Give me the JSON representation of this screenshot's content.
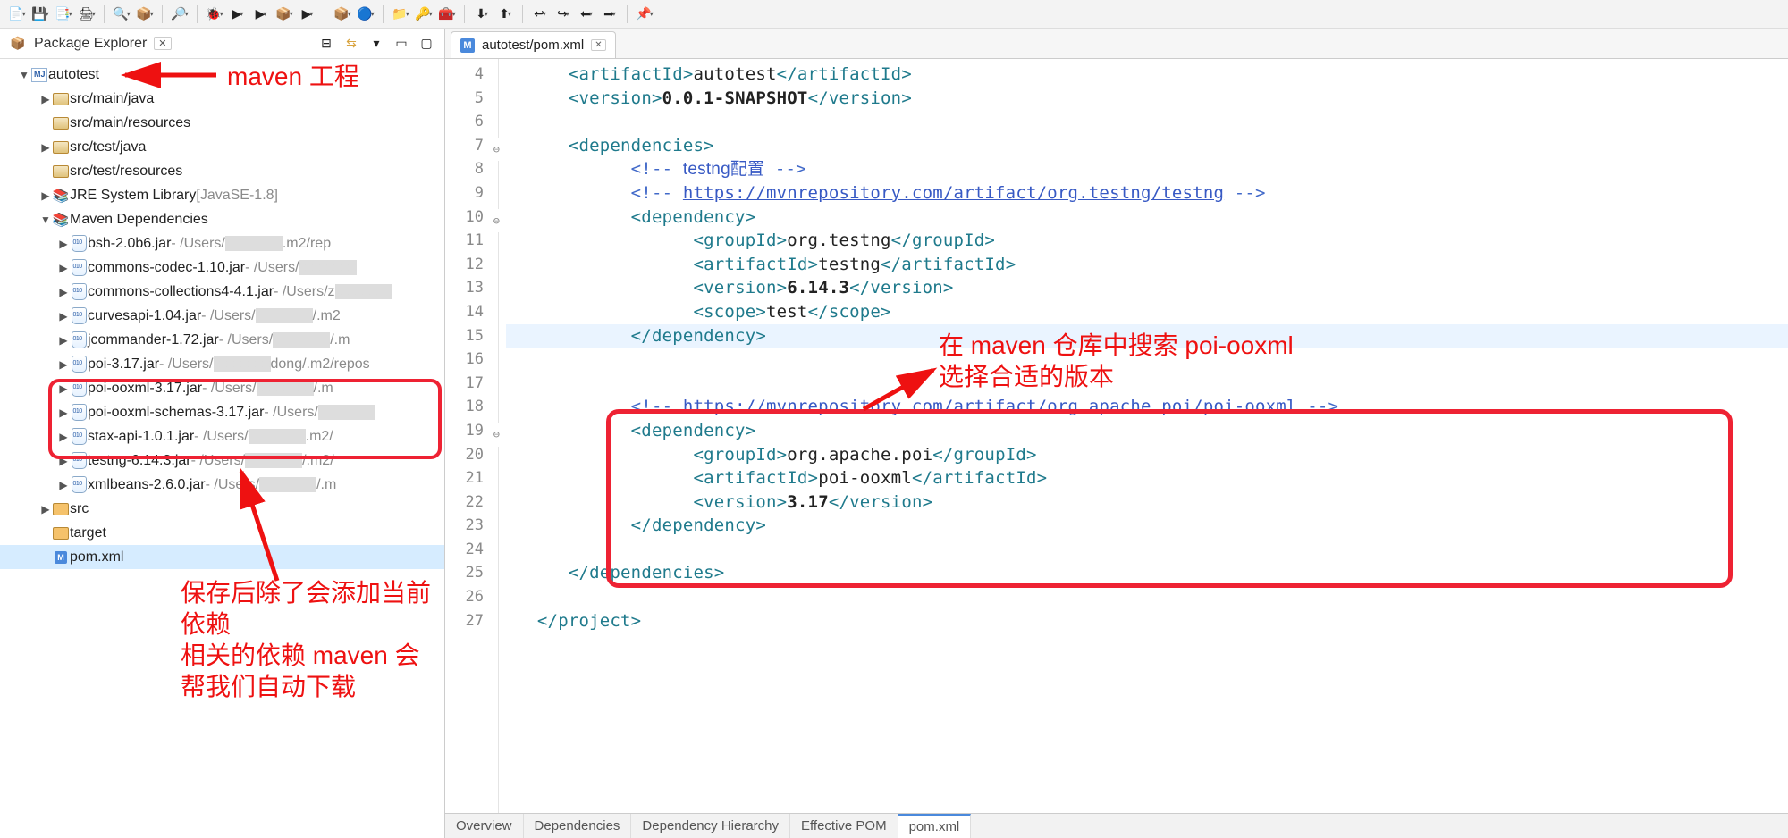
{
  "toolbar_icons": [
    "📄",
    "💾",
    "📑",
    "🖨",
    "🔍",
    "📦",
    "🔎",
    "🐞",
    "▶",
    "▶",
    "📦",
    "▶",
    "📦",
    "🔵",
    "📁",
    "🔑",
    "🧰",
    "⬇",
    "⬆",
    "↩",
    "↪",
    "⬅",
    "➡",
    "📌"
  ],
  "view": {
    "title": "Package Explorer"
  },
  "annotations": {
    "maven_proj": "maven 工程",
    "right_note_1": "在 maven 仓库中搜索 poi-ooxml",
    "right_note_2": "选择合适的版本",
    "bottom_note_1": "保存后除了会添加当前依赖",
    "bottom_note_2": "相关的依赖 maven 会",
    "bottom_note_3": "帮我们自动下载"
  },
  "tree": {
    "project": "autotest",
    "srcMainJava": "src/main/java",
    "srcMainRes": "src/main/resources",
    "srcTestJava": "src/test/java",
    "srcTestRes": "src/test/resources",
    "jre": "JRE System Library",
    "jreDeco": " [JavaSE-1.8]",
    "mavenDeps": "Maven Dependencies",
    "jars": [
      {
        "n": "bsh-2.0b6.jar",
        "p": " - /Users/",
        "t": ".m2/rep"
      },
      {
        "n": "commons-codec-1.10.jar",
        "p": " - /Users/",
        "t": ""
      },
      {
        "n": "commons-collections4-4.1.jar",
        "p": " - /Users/z",
        "t": ""
      },
      {
        "n": "curvesapi-1.04.jar",
        "p": " - /Users/",
        "t": "/.m2"
      },
      {
        "n": "jcommander-1.72.jar",
        "p": " - /Users/",
        "t": "/.m"
      },
      {
        "n": "poi-3.17.jar",
        "p": " - /Users/",
        "t": "dong/.m2/repos"
      },
      {
        "n": "poi-ooxml-3.17.jar",
        "p": " - /Users/",
        "t": "/.m"
      },
      {
        "n": "poi-ooxml-schemas-3.17.jar",
        "p": " - /Users/",
        "t": ""
      },
      {
        "n": "stax-api-1.0.1.jar",
        "p": " - /Users/",
        "t": ".m2/"
      },
      {
        "n": "testng-6.14.3.jar",
        "p": " - /Users/",
        "t": "/.m2/"
      },
      {
        "n": "xmlbeans-2.6.0.jar",
        "p": " - /Users/",
        "t": "/.m"
      }
    ],
    "srcFolder": "src",
    "targetFolder": "target",
    "pom": "pom.xml"
  },
  "editor": {
    "tabTitle": "autotest/pom.xml",
    "lines": [
      {
        "n": 4,
        "indent": 2,
        "parts": [
          [
            "tag",
            "<artifactId>"
          ],
          [
            "txt",
            "autotest"
          ],
          [
            "tag",
            "</artifactId>"
          ]
        ]
      },
      {
        "n": 5,
        "indent": 2,
        "parts": [
          [
            "tag",
            "<version>"
          ],
          [
            "bold",
            "0.0.1-SNAPSHOT"
          ],
          [
            "tag",
            "</version>"
          ]
        ]
      },
      {
        "n": 6,
        "indent": 0,
        "parts": []
      },
      {
        "n": 7,
        "fold": true,
        "indent": 2,
        "parts": [
          [
            "tag",
            "<dependencies>"
          ]
        ]
      },
      {
        "n": 8,
        "indent": 4,
        "parts": [
          [
            "com",
            "<!-- "
          ],
          [
            "cn",
            "testng配置"
          ],
          [
            "com",
            " -->"
          ]
        ]
      },
      {
        "n": 9,
        "indent": 4,
        "parts": [
          [
            "com",
            "<!-- "
          ],
          [
            "url",
            "https://mvnrepository.com/artifact/org.testng/testng"
          ],
          [
            "com",
            " -->"
          ]
        ]
      },
      {
        "n": 10,
        "fold": true,
        "indent": 4,
        "parts": [
          [
            "tag",
            "<dependency>"
          ]
        ]
      },
      {
        "n": 11,
        "indent": 6,
        "parts": [
          [
            "tag",
            "<groupId>"
          ],
          [
            "txt",
            "org.testng"
          ],
          [
            "tag",
            "</groupId>"
          ]
        ]
      },
      {
        "n": 12,
        "indent": 6,
        "parts": [
          [
            "tag",
            "<artifactId>"
          ],
          [
            "txt",
            "testng"
          ],
          [
            "tag",
            "</artifactId>"
          ]
        ]
      },
      {
        "n": 13,
        "indent": 6,
        "parts": [
          [
            "tag",
            "<version>"
          ],
          [
            "bold",
            "6.14.3"
          ],
          [
            "tag",
            "</version>"
          ]
        ]
      },
      {
        "n": 14,
        "indent": 6,
        "parts": [
          [
            "tag",
            "<scope>"
          ],
          [
            "txt",
            "test"
          ],
          [
            "tag",
            "</scope>"
          ]
        ]
      },
      {
        "n": 15,
        "hl": true,
        "indent": 4,
        "parts": [
          [
            "tag",
            "</dependency>"
          ]
        ]
      },
      {
        "n": 16,
        "indent": 0,
        "parts": []
      },
      {
        "n": 17,
        "indent": 0,
        "parts": []
      },
      {
        "n": 18,
        "indent": 4,
        "parts": [
          [
            "com",
            "<!-- "
          ],
          [
            "url",
            "https://mvnrepository.com/artifact/org.apache.poi/poi-ooxml"
          ],
          [
            "com",
            " -->"
          ]
        ]
      },
      {
        "n": 19,
        "fold": true,
        "indent": 4,
        "parts": [
          [
            "tag",
            "<dependency>"
          ]
        ]
      },
      {
        "n": 20,
        "indent": 6,
        "parts": [
          [
            "tag",
            "<groupId>"
          ],
          [
            "txt",
            "org.apache.poi"
          ],
          [
            "tag",
            "</groupId>"
          ]
        ]
      },
      {
        "n": 21,
        "indent": 6,
        "parts": [
          [
            "tag",
            "<artifactId>"
          ],
          [
            "txt",
            "poi-ooxml"
          ],
          [
            "tag",
            "</artifactId>"
          ]
        ]
      },
      {
        "n": 22,
        "indent": 6,
        "parts": [
          [
            "tag",
            "<version>"
          ],
          [
            "bold",
            "3.17"
          ],
          [
            "tag",
            "</version>"
          ]
        ]
      },
      {
        "n": 23,
        "indent": 4,
        "parts": [
          [
            "tag",
            "</dependency>"
          ]
        ]
      },
      {
        "n": 24,
        "indent": 0,
        "parts": []
      },
      {
        "n": 25,
        "indent": 2,
        "parts": [
          [
            "tag",
            "</dependencies>"
          ]
        ]
      },
      {
        "n": 26,
        "indent": 0,
        "parts": []
      },
      {
        "n": 27,
        "indent": 1,
        "parts": [
          [
            "tag",
            "</project>"
          ]
        ]
      }
    ],
    "bottomTabs": [
      "Overview",
      "Dependencies",
      "Dependency Hierarchy",
      "Effective POM",
      "pom.xml"
    ]
  }
}
